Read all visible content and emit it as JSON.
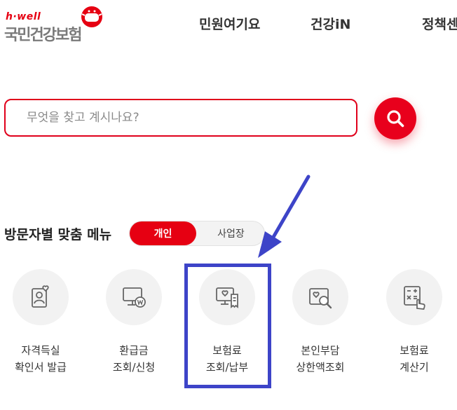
{
  "brand": {
    "sub": "h·well",
    "name": "국민건강보험"
  },
  "nav": {
    "items": [
      "민원여기요",
      "건강iN",
      "정책센"
    ]
  },
  "search": {
    "placeholder": "무엇을 찾고 계시나요?"
  },
  "section": {
    "title": "방문자별 맞춤 메뉴",
    "toggle": {
      "active": "개인",
      "inactive": "사업장"
    }
  },
  "menu": [
    {
      "line1": "자격득실",
      "line2": "확인서 발급",
      "icon": "person-heart-icon"
    },
    {
      "line1": "환급금",
      "line2": "조회/신청",
      "icon": "monitor-won-icon"
    },
    {
      "line1": "보험료",
      "line2": "조회/납부",
      "icon": "bill-heart-icon"
    },
    {
      "line1": "본인부담",
      "line2": "상한액조회",
      "icon": "search-heart-icon"
    },
    {
      "line1": "보험료",
      "line2": "계산기",
      "icon": "calculator-hand-icon"
    }
  ],
  "colors": {
    "brand_red": "#e60012",
    "annotation_blue": "#3d44c8",
    "icon_gray": "#666666"
  }
}
